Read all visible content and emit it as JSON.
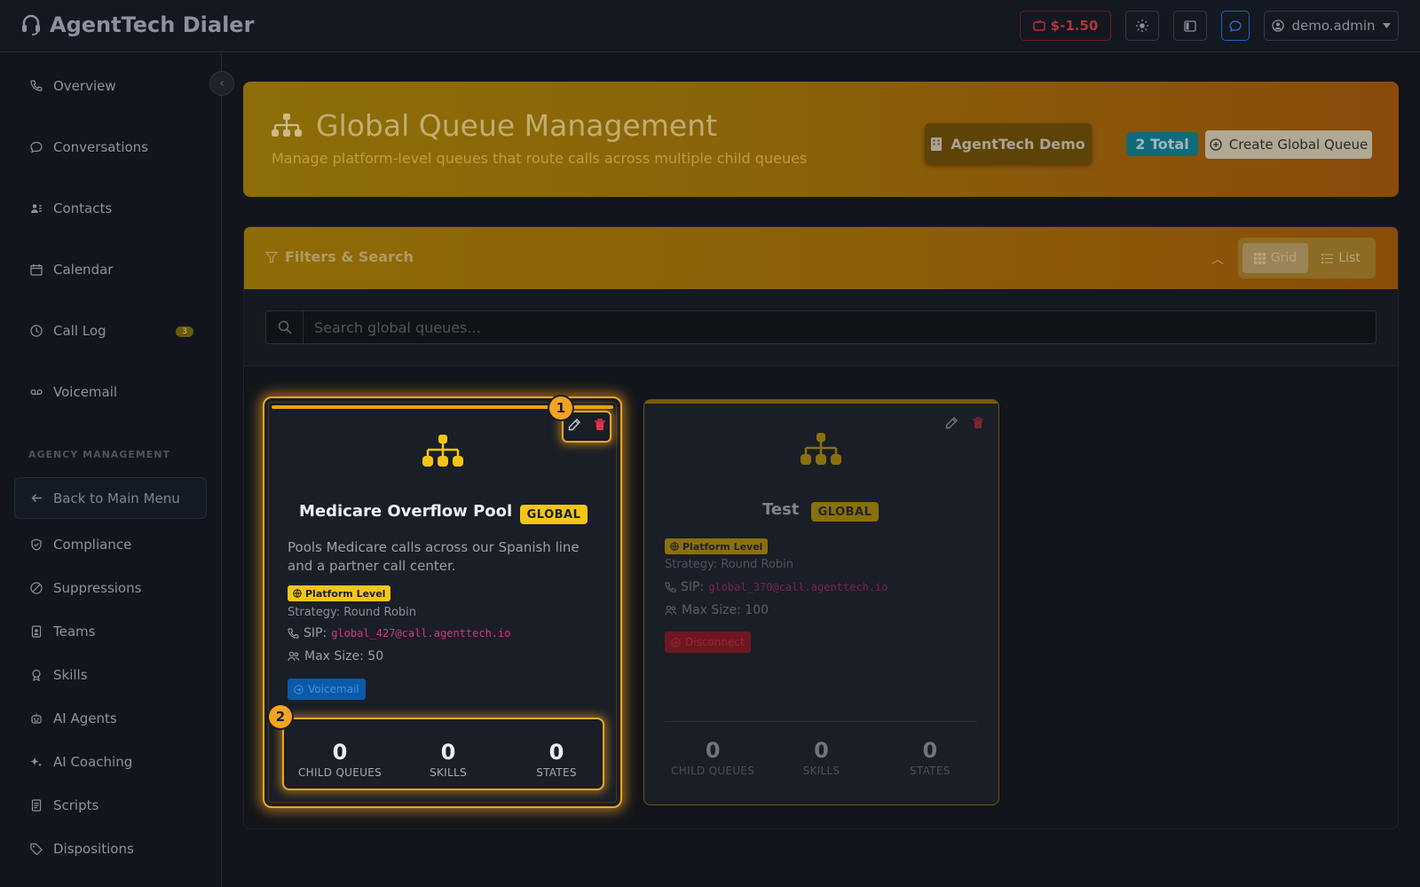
{
  "app": {
    "title": "AgentTech Dialer"
  },
  "topbar": {
    "balance": "$-1.50",
    "user": "demo.admin"
  },
  "sidebar": {
    "items": [
      {
        "label": "Overview"
      },
      {
        "label": "Conversations"
      },
      {
        "label": "Contacts"
      },
      {
        "label": "Calendar"
      },
      {
        "label": "Call Log",
        "badge": "3"
      },
      {
        "label": "Voicemail"
      }
    ],
    "section_label": "AGENCY MANAGEMENT",
    "back_label": "Back to Main Menu",
    "agency_items": [
      {
        "label": "Compliance"
      },
      {
        "label": "Suppressions"
      },
      {
        "label": "Teams"
      },
      {
        "label": "Skills"
      },
      {
        "label": "AI Agents"
      },
      {
        "label": "AI Coaching"
      },
      {
        "label": "Scripts"
      },
      {
        "label": "Dispositions"
      }
    ]
  },
  "header": {
    "title": "Global Queue Management",
    "subtitle": "Manage platform-level queues that route calls across multiple child queues",
    "org_button": "AgentTech Demo",
    "total_badge": "2 Total",
    "create_button": "Create Global Queue"
  },
  "filters": {
    "title": "Filters & Search",
    "view_grid": "Grid",
    "view_list": "List",
    "search_placeholder": "Search global queues..."
  },
  "queues": [
    {
      "name": "Medicare Overflow Pool",
      "badge": "GLOBAL",
      "description": "Pools Medicare calls across our Spanish line and a partner call center.",
      "level": "Platform Level",
      "strategy": "Strategy: Round Robin",
      "sip_label": "SIP:",
      "sip": "global_427@call.agenttech.io",
      "max_size": "Max Size: 50",
      "tag": "Voicemail",
      "stats": {
        "child_queues": "0",
        "skills": "0",
        "states": "0"
      }
    },
    {
      "name": "Test",
      "badge": "GLOBAL",
      "level": "Platform Level",
      "strategy": "Strategy: Round Robin",
      "sip_label": "SIP:",
      "sip": "global_370@call.agenttech.io",
      "max_size": "Max Size: 100",
      "tag": "Disconnect",
      "stats": {
        "child_queues": "0",
        "skills": "0",
        "states": "0"
      }
    }
  ],
  "stat_labels": {
    "child_queues": "CHILD QUEUES",
    "skills": "SKILLS",
    "states": "STATES"
  },
  "markers": [
    "1",
    "2"
  ],
  "colors": {
    "accent": "#f3a423",
    "global_badge": "#f5c518",
    "sip": "#d63384",
    "voicemail": "#0d6efd",
    "danger": "#dc3545"
  }
}
